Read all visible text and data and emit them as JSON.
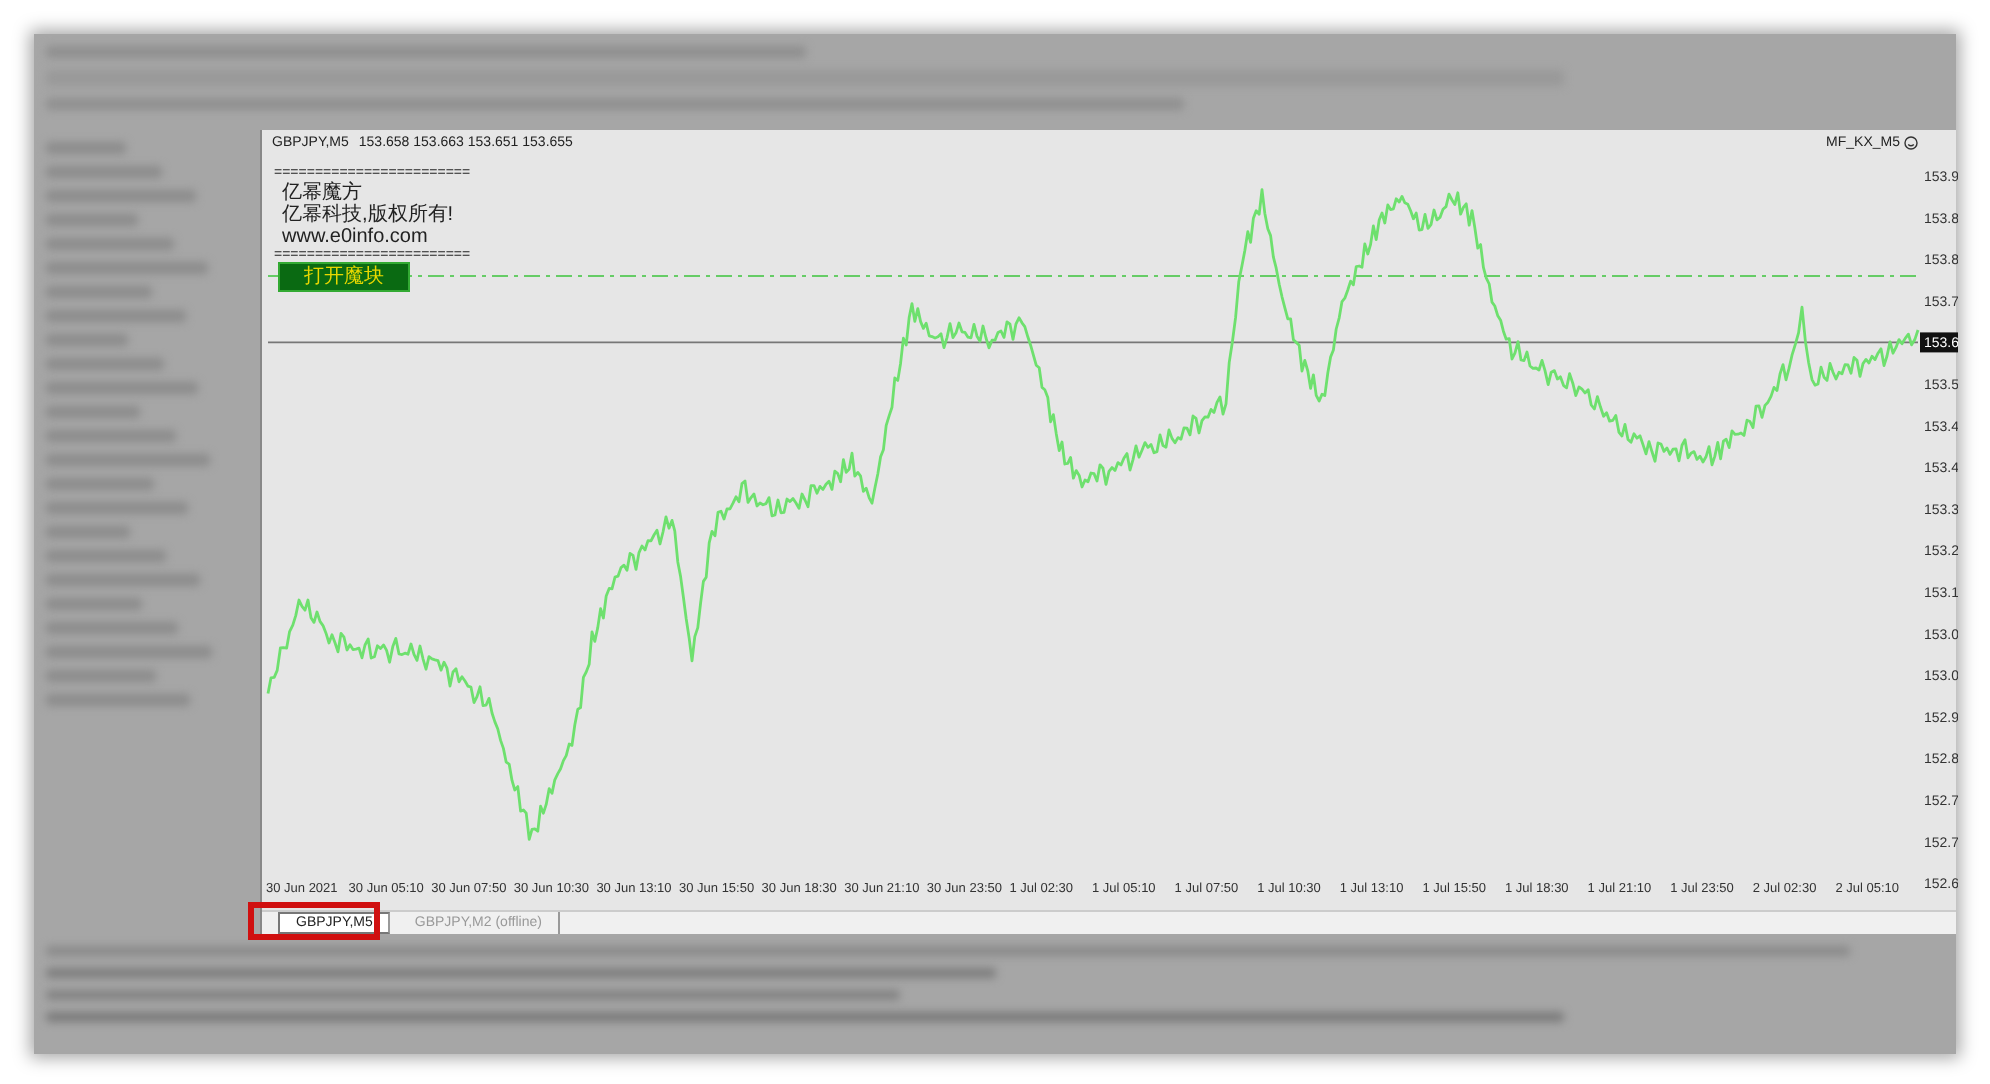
{
  "chart_window": {
    "symbol": "GBPJPY,M5",
    "quotes": "153.658 153.663 153.651 153.655",
    "indicator_name": "MF_KX_M5",
    "info_lines": [
      "========================",
      "亿幂魔方",
      "亿幂科技,版权所有!",
      "www.e0info.com",
      "========================"
    ],
    "open_button": "打开魔块",
    "price_axis_labels": [
      "153.9",
      "153.8",
      "153.8",
      "153.7",
      "153.5",
      "153.4",
      "153.4",
      "153.3",
      "153.2",
      "153.1",
      "153.0",
      "153.0",
      "152.9",
      "152.8",
      "152.7",
      "152.7",
      "152.6"
    ],
    "current_price": "153.6",
    "time_axis_labels": [
      "30 Jun 2021",
      "30 Jun 05:10",
      "30 Jun 07:50",
      "30 Jun 10:30",
      "30 Jun 13:10",
      "30 Jun 15:50",
      "30 Jun 18:30",
      "30 Jun 21:10",
      "30 Jun 23:50",
      "1 Jul 02:30",
      "1 Jul 05:10",
      "1 Jul 07:50",
      "1 Jul 10:30",
      "1 Jul 13:10",
      "1 Jul 15:50",
      "1 Jul 18:30",
      "1 Jul 21:10",
      "1 Jul 23:50",
      "2 Jul 02:30",
      "2 Jul 05:10"
    ]
  },
  "chart_tabs": [
    {
      "label": "GBPJPY,M5",
      "selected": true
    },
    {
      "label": "GBPJPY,M2 (offline)",
      "selected": false
    }
  ]
}
